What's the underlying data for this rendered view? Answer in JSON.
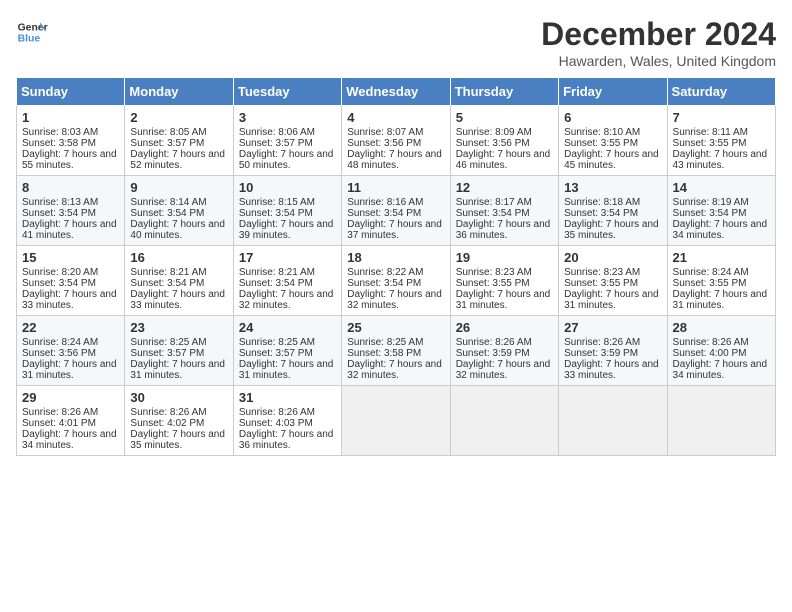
{
  "header": {
    "logo_line1": "General",
    "logo_line2": "Blue",
    "title": "December 2024",
    "location": "Hawarden, Wales, United Kingdom"
  },
  "days_of_week": [
    "Sunday",
    "Monday",
    "Tuesday",
    "Wednesday",
    "Thursday",
    "Friday",
    "Saturday"
  ],
  "weeks": [
    [
      {
        "day": 1,
        "sunrise": "8:03 AM",
        "sunset": "3:58 PM",
        "daylight": "7 hours and 55 minutes."
      },
      {
        "day": 2,
        "sunrise": "8:05 AM",
        "sunset": "3:57 PM",
        "daylight": "7 hours and 52 minutes."
      },
      {
        "day": 3,
        "sunrise": "8:06 AM",
        "sunset": "3:57 PM",
        "daylight": "7 hours and 50 minutes."
      },
      {
        "day": 4,
        "sunrise": "8:07 AM",
        "sunset": "3:56 PM",
        "daylight": "7 hours and 48 minutes."
      },
      {
        "day": 5,
        "sunrise": "8:09 AM",
        "sunset": "3:56 PM",
        "daylight": "7 hours and 46 minutes."
      },
      {
        "day": 6,
        "sunrise": "8:10 AM",
        "sunset": "3:55 PM",
        "daylight": "7 hours and 45 minutes."
      },
      {
        "day": 7,
        "sunrise": "8:11 AM",
        "sunset": "3:55 PM",
        "daylight": "7 hours and 43 minutes."
      }
    ],
    [
      {
        "day": 8,
        "sunrise": "8:13 AM",
        "sunset": "3:54 PM",
        "daylight": "7 hours and 41 minutes."
      },
      {
        "day": 9,
        "sunrise": "8:14 AM",
        "sunset": "3:54 PM",
        "daylight": "7 hours and 40 minutes."
      },
      {
        "day": 10,
        "sunrise": "8:15 AM",
        "sunset": "3:54 PM",
        "daylight": "7 hours and 39 minutes."
      },
      {
        "day": 11,
        "sunrise": "8:16 AM",
        "sunset": "3:54 PM",
        "daylight": "7 hours and 37 minutes."
      },
      {
        "day": 12,
        "sunrise": "8:17 AM",
        "sunset": "3:54 PM",
        "daylight": "7 hours and 36 minutes."
      },
      {
        "day": 13,
        "sunrise": "8:18 AM",
        "sunset": "3:54 PM",
        "daylight": "7 hours and 35 minutes."
      },
      {
        "day": 14,
        "sunrise": "8:19 AM",
        "sunset": "3:54 PM",
        "daylight": "7 hours and 34 minutes."
      }
    ],
    [
      {
        "day": 15,
        "sunrise": "8:20 AM",
        "sunset": "3:54 PM",
        "daylight": "7 hours and 33 minutes."
      },
      {
        "day": 16,
        "sunrise": "8:21 AM",
        "sunset": "3:54 PM",
        "daylight": "7 hours and 33 minutes."
      },
      {
        "day": 17,
        "sunrise": "8:21 AM",
        "sunset": "3:54 PM",
        "daylight": "7 hours and 32 minutes."
      },
      {
        "day": 18,
        "sunrise": "8:22 AM",
        "sunset": "3:54 PM",
        "daylight": "7 hours and 32 minutes."
      },
      {
        "day": 19,
        "sunrise": "8:23 AM",
        "sunset": "3:55 PM",
        "daylight": "7 hours and 31 minutes."
      },
      {
        "day": 20,
        "sunrise": "8:23 AM",
        "sunset": "3:55 PM",
        "daylight": "7 hours and 31 minutes."
      },
      {
        "day": 21,
        "sunrise": "8:24 AM",
        "sunset": "3:55 PM",
        "daylight": "7 hours and 31 minutes."
      }
    ],
    [
      {
        "day": 22,
        "sunrise": "8:24 AM",
        "sunset": "3:56 PM",
        "daylight": "7 hours and 31 minutes."
      },
      {
        "day": 23,
        "sunrise": "8:25 AM",
        "sunset": "3:57 PM",
        "daylight": "7 hours and 31 minutes."
      },
      {
        "day": 24,
        "sunrise": "8:25 AM",
        "sunset": "3:57 PM",
        "daylight": "7 hours and 31 minutes."
      },
      {
        "day": 25,
        "sunrise": "8:25 AM",
        "sunset": "3:58 PM",
        "daylight": "7 hours and 32 minutes."
      },
      {
        "day": 26,
        "sunrise": "8:26 AM",
        "sunset": "3:59 PM",
        "daylight": "7 hours and 32 minutes."
      },
      {
        "day": 27,
        "sunrise": "8:26 AM",
        "sunset": "3:59 PM",
        "daylight": "7 hours and 33 minutes."
      },
      {
        "day": 28,
        "sunrise": "8:26 AM",
        "sunset": "4:00 PM",
        "daylight": "7 hours and 34 minutes."
      }
    ],
    [
      {
        "day": 29,
        "sunrise": "8:26 AM",
        "sunset": "4:01 PM",
        "daylight": "7 hours and 34 minutes."
      },
      {
        "day": 30,
        "sunrise": "8:26 AM",
        "sunset": "4:02 PM",
        "daylight": "7 hours and 35 minutes."
      },
      {
        "day": 31,
        "sunrise": "8:26 AM",
        "sunset": "4:03 PM",
        "daylight": "7 hours and 36 minutes."
      },
      null,
      null,
      null,
      null
    ]
  ]
}
